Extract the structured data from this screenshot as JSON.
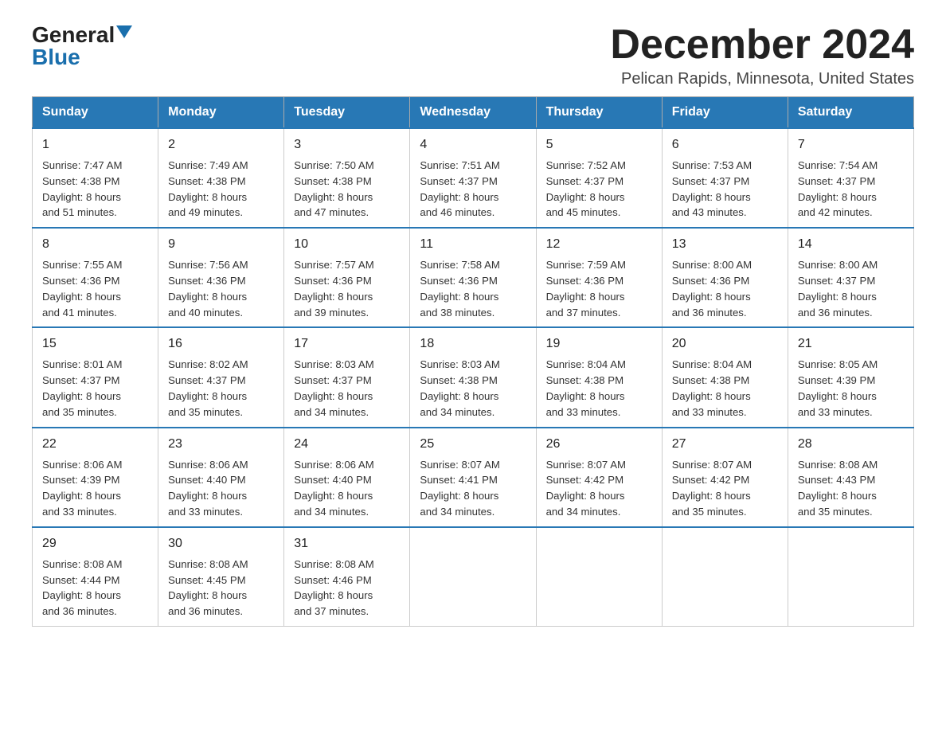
{
  "header": {
    "logo_general": "General",
    "logo_blue": "Blue",
    "month_title": "December 2024",
    "location": "Pelican Rapids, Minnesota, United States"
  },
  "calendar": {
    "days_of_week": [
      "Sunday",
      "Monday",
      "Tuesday",
      "Wednesday",
      "Thursday",
      "Friday",
      "Saturday"
    ],
    "weeks": [
      [
        {
          "day": "1",
          "info": "Sunrise: 7:47 AM\nSunset: 4:38 PM\nDaylight: 8 hours\nand 51 minutes."
        },
        {
          "day": "2",
          "info": "Sunrise: 7:49 AM\nSunset: 4:38 PM\nDaylight: 8 hours\nand 49 minutes."
        },
        {
          "day": "3",
          "info": "Sunrise: 7:50 AM\nSunset: 4:38 PM\nDaylight: 8 hours\nand 47 minutes."
        },
        {
          "day": "4",
          "info": "Sunrise: 7:51 AM\nSunset: 4:37 PM\nDaylight: 8 hours\nand 46 minutes."
        },
        {
          "day": "5",
          "info": "Sunrise: 7:52 AM\nSunset: 4:37 PM\nDaylight: 8 hours\nand 45 minutes."
        },
        {
          "day": "6",
          "info": "Sunrise: 7:53 AM\nSunset: 4:37 PM\nDaylight: 8 hours\nand 43 minutes."
        },
        {
          "day": "7",
          "info": "Sunrise: 7:54 AM\nSunset: 4:37 PM\nDaylight: 8 hours\nand 42 minutes."
        }
      ],
      [
        {
          "day": "8",
          "info": "Sunrise: 7:55 AM\nSunset: 4:36 PM\nDaylight: 8 hours\nand 41 minutes."
        },
        {
          "day": "9",
          "info": "Sunrise: 7:56 AM\nSunset: 4:36 PM\nDaylight: 8 hours\nand 40 minutes."
        },
        {
          "day": "10",
          "info": "Sunrise: 7:57 AM\nSunset: 4:36 PM\nDaylight: 8 hours\nand 39 minutes."
        },
        {
          "day": "11",
          "info": "Sunrise: 7:58 AM\nSunset: 4:36 PM\nDaylight: 8 hours\nand 38 minutes."
        },
        {
          "day": "12",
          "info": "Sunrise: 7:59 AM\nSunset: 4:36 PM\nDaylight: 8 hours\nand 37 minutes."
        },
        {
          "day": "13",
          "info": "Sunrise: 8:00 AM\nSunset: 4:36 PM\nDaylight: 8 hours\nand 36 minutes."
        },
        {
          "day": "14",
          "info": "Sunrise: 8:00 AM\nSunset: 4:37 PM\nDaylight: 8 hours\nand 36 minutes."
        }
      ],
      [
        {
          "day": "15",
          "info": "Sunrise: 8:01 AM\nSunset: 4:37 PM\nDaylight: 8 hours\nand 35 minutes."
        },
        {
          "day": "16",
          "info": "Sunrise: 8:02 AM\nSunset: 4:37 PM\nDaylight: 8 hours\nand 35 minutes."
        },
        {
          "day": "17",
          "info": "Sunrise: 8:03 AM\nSunset: 4:37 PM\nDaylight: 8 hours\nand 34 minutes."
        },
        {
          "day": "18",
          "info": "Sunrise: 8:03 AM\nSunset: 4:38 PM\nDaylight: 8 hours\nand 34 minutes."
        },
        {
          "day": "19",
          "info": "Sunrise: 8:04 AM\nSunset: 4:38 PM\nDaylight: 8 hours\nand 33 minutes."
        },
        {
          "day": "20",
          "info": "Sunrise: 8:04 AM\nSunset: 4:38 PM\nDaylight: 8 hours\nand 33 minutes."
        },
        {
          "day": "21",
          "info": "Sunrise: 8:05 AM\nSunset: 4:39 PM\nDaylight: 8 hours\nand 33 minutes."
        }
      ],
      [
        {
          "day": "22",
          "info": "Sunrise: 8:06 AM\nSunset: 4:39 PM\nDaylight: 8 hours\nand 33 minutes."
        },
        {
          "day": "23",
          "info": "Sunrise: 8:06 AM\nSunset: 4:40 PM\nDaylight: 8 hours\nand 33 minutes."
        },
        {
          "day": "24",
          "info": "Sunrise: 8:06 AM\nSunset: 4:40 PM\nDaylight: 8 hours\nand 34 minutes."
        },
        {
          "day": "25",
          "info": "Sunrise: 8:07 AM\nSunset: 4:41 PM\nDaylight: 8 hours\nand 34 minutes."
        },
        {
          "day": "26",
          "info": "Sunrise: 8:07 AM\nSunset: 4:42 PM\nDaylight: 8 hours\nand 34 minutes."
        },
        {
          "day": "27",
          "info": "Sunrise: 8:07 AM\nSunset: 4:42 PM\nDaylight: 8 hours\nand 35 minutes."
        },
        {
          "day": "28",
          "info": "Sunrise: 8:08 AM\nSunset: 4:43 PM\nDaylight: 8 hours\nand 35 minutes."
        }
      ],
      [
        {
          "day": "29",
          "info": "Sunrise: 8:08 AM\nSunset: 4:44 PM\nDaylight: 8 hours\nand 36 minutes."
        },
        {
          "day": "30",
          "info": "Sunrise: 8:08 AM\nSunset: 4:45 PM\nDaylight: 8 hours\nand 36 minutes."
        },
        {
          "day": "31",
          "info": "Sunrise: 8:08 AM\nSunset: 4:46 PM\nDaylight: 8 hours\nand 37 minutes."
        },
        {
          "day": "",
          "info": ""
        },
        {
          "day": "",
          "info": ""
        },
        {
          "day": "",
          "info": ""
        },
        {
          "day": "",
          "info": ""
        }
      ]
    ]
  }
}
